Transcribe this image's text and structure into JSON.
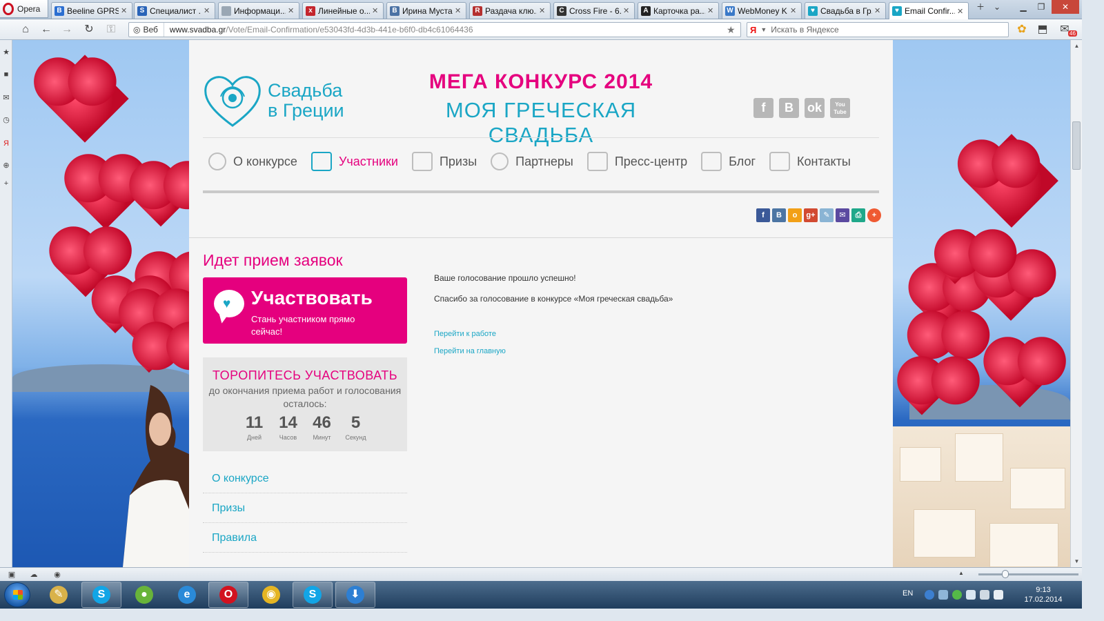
{
  "browser": {
    "app_button_label": "Opera",
    "tabs": [
      {
        "title": "Beeline GPRS...",
        "color": "#2c6fd1",
        "glyph": "B"
      },
      {
        "title": "Специалист ...",
        "color": "#2a64b8",
        "glyph": "S"
      },
      {
        "title": "Информаци...",
        "color": "#9aa7b4",
        "glyph": ""
      },
      {
        "title": "Линейные о...",
        "color": "#c4262e",
        "glyph": "x"
      },
      {
        "title": "Ирина Муста...",
        "color": "#4b72a4",
        "glyph": "B"
      },
      {
        "title": "Раздача клю...",
        "color": "#b5302f",
        "glyph": "R"
      },
      {
        "title": "Cross Fire - 6...",
        "color": "#333333",
        "glyph": "C"
      },
      {
        "title": "Карточка ра...",
        "color": "#222222",
        "glyph": "A"
      },
      {
        "title": "WebMoney K...",
        "color": "#3a79c8",
        "glyph": "W"
      },
      {
        "title": "Свадьба в Гр...",
        "color": "#1aa6c5",
        "glyph": "♥"
      },
      {
        "title": "Email Confir...",
        "color": "#1aa6c5",
        "glyph": "♥",
        "active": true
      }
    ],
    "address": {
      "scheme_label": "Веб",
      "domain": "www.svadba.gr",
      "path": "/Vote/Email-Confirmation/e53043fd-4d3b-441e-b6f0-db4c61064436"
    },
    "search_placeholder": "Искать в Яндексе",
    "mail_badge": "46"
  },
  "site": {
    "logo_line1": "Свадьба",
    "logo_line2": "в Греции",
    "contest_line1": "МЕГА КОНКУРС 2014",
    "contest_line2": "МОЯ ГРЕЧЕСКАЯ СВАДЬБА",
    "social_top": [
      {
        "label": "f",
        "icon": "facebook-icon"
      },
      {
        "label": "B",
        "icon": "vkontakte-icon"
      },
      {
        "label": "ok",
        "icon": "odnoklassniki-icon"
      },
      {
        "label": "You Tube",
        "icon": "youtube-icon"
      }
    ],
    "menu": [
      {
        "label": "О конкурсе",
        "icon": "heart-outline-icon"
      },
      {
        "label": "Участники",
        "icon": "camera-icon",
        "active": true
      },
      {
        "label": "Призы",
        "icon": "award-icon"
      },
      {
        "label": "Партнеры",
        "icon": "user-icon"
      },
      {
        "label": "Пресс-центр",
        "icon": "newspaper-icon"
      },
      {
        "label": "Блог",
        "icon": "speech-bubble-icon"
      },
      {
        "label": "Контакты",
        "icon": "envelope-icon"
      }
    ],
    "share": [
      {
        "label": "f",
        "color": "#3b5998",
        "icon": "facebook-share-icon"
      },
      {
        "label": "B",
        "color": "#4c75a3",
        "icon": "vk-share-icon"
      },
      {
        "label": "o",
        "color": "#f2a017",
        "icon": "ok-share-icon"
      },
      {
        "label": "g+",
        "color": "#d24a31",
        "icon": "google-plus-share-icon"
      },
      {
        "label": "✎",
        "color": "#8ab4d4",
        "icon": "livejournal-share-icon"
      },
      {
        "label": "✉",
        "color": "#5b4aa0",
        "icon": "email-share-icon"
      },
      {
        "label": "⎙",
        "color": "#1fa88a",
        "icon": "print-share-icon"
      },
      {
        "label": "+",
        "color": "#ef5a32",
        "icon": "more-share-icon"
      }
    ],
    "sidebar": {
      "status_title": "Идет прием заявок",
      "cta_title": "Участвовать",
      "cta_subtitle": "Стань участником прямо сейчас!",
      "timer_title": "ТОРОПИТЕСЬ УЧАСТВОВАТЬ",
      "timer_subtitle": "до окончания приема работ и голосования осталось:",
      "countdown": [
        {
          "value": "11",
          "unit": "Дней"
        },
        {
          "value": "14",
          "unit": "Часов"
        },
        {
          "value": "46",
          "unit": "Минут"
        },
        {
          "value": "5",
          "unit": "Секунд"
        }
      ],
      "links": [
        "О конкурсе",
        "Призы",
        "Правила"
      ]
    },
    "content": {
      "message1": "Ваше голосование прошло успешно!",
      "message2": "Спасибо за голосование в конкурсе «Моя греческая свадьба»",
      "link_work": "Перейти к работе",
      "link_home": "Перейти на главную"
    },
    "colors": {
      "accent_pink": "#e5007e",
      "accent_teal": "#1aa6c5"
    }
  },
  "taskbar": {
    "apps": [
      {
        "name": "paint-app",
        "glyph": "✎",
        "color": "#d9b24a",
        "open": false
      },
      {
        "name": "skype-app",
        "glyph": "S",
        "color": "#12a5e6",
        "open": true
      },
      {
        "name": "green-orb-app",
        "glyph": "●",
        "color": "#68b43a",
        "open": false
      },
      {
        "name": "internet-explorer-app",
        "glyph": "e",
        "color": "#2a8ad8",
        "open": false
      },
      {
        "name": "opera-app",
        "glyph": "O",
        "color": "#d2121f",
        "open": true
      },
      {
        "name": "chrome-app",
        "glyph": "◉",
        "color": "#e5b523",
        "open": false
      },
      {
        "name": "skype-app-2",
        "glyph": "S",
        "color": "#12a5e6",
        "open": true
      },
      {
        "name": "download-app",
        "glyph": "⬇",
        "color": "#2d7fd3",
        "open": true
      }
    ],
    "language": "EN",
    "time": "9:13",
    "date": "17.02.2014"
  }
}
